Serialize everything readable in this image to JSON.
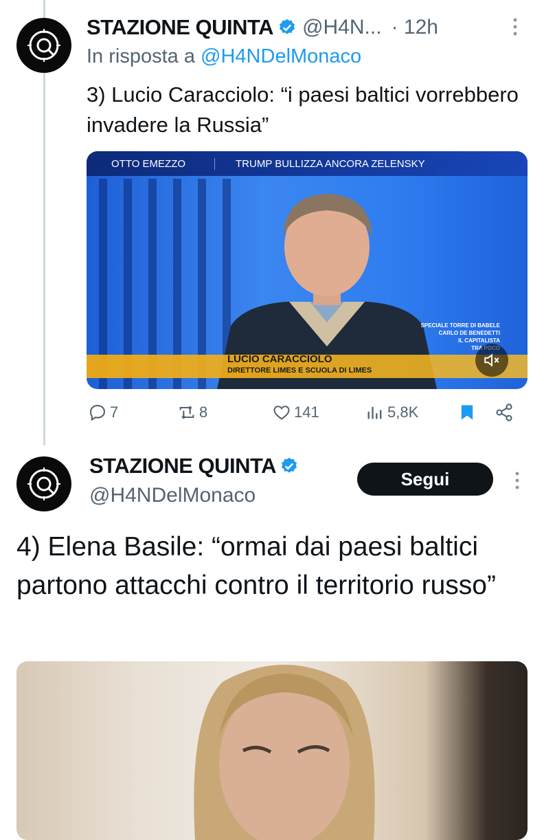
{
  "tweet1": {
    "author_name": "STAZIONE QUINTA",
    "handle": "@H4N...",
    "time_sep": "·",
    "time": "12h",
    "reply_prefix": "In risposta a",
    "reply_handle": "@H4NDelMonaco",
    "text": "3) Lucio Caracciolo: “i paesi baltici vorrebbero invadere la Russia”",
    "video": {
      "show_name": "OTTO EMEZZO",
      "headline": "TRUMP BULLIZZA ANCORA ZELENSKY",
      "lower_third_name": "LUCIO CARACCIOLO",
      "lower_third_role": "DIRETTORE LIMES E SCUOLA DI LIMES",
      "side_line1": "SPECIALE TORRE DI BABELE",
      "side_line2": "CARLO DE BENEDETTI",
      "side_line3": "IL CAPITALISTA",
      "side_line4": "TRA POCO",
      "mute_icon": "speaker-mute-icon"
    },
    "actions": {
      "replies": "7",
      "reposts": "8",
      "likes": "141",
      "views": "5,8K"
    }
  },
  "tweet2": {
    "author_name": "STAZIONE QUINTA",
    "handle": "@H4NDelMonaco",
    "follow_label": "Segui",
    "text": "4) Elena Basile: “ormai dai paesi baltici partono attacchi contro il territorio russo”"
  },
  "colors": {
    "link": "#1d9bf0",
    "muted": "#536471",
    "verified": "#1d9bf0",
    "bookmark": "#1d9bf0",
    "follow_bg": "#0f1419"
  }
}
